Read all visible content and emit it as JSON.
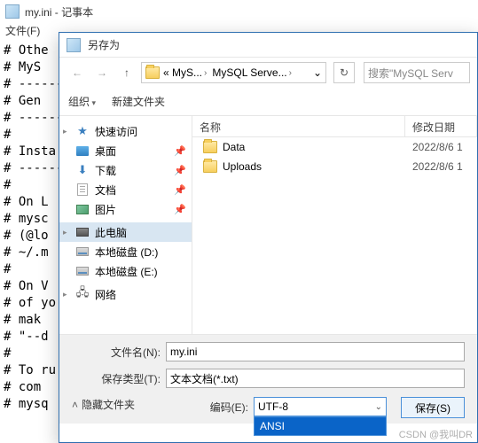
{
  "notepad": {
    "title": "my.ini - 记事本",
    "menu_file": "文件(F)",
    "body": "# Othe\n# MyS\n# ------\n# Gen\n# ------\n#\n# Insta\n# ------\n#\n# On L\n# mysc\n# (@lo\n# ~/.m\n#\n# On V\n# of yo\n# mak\n# \"--d\n#\n# To ru\n# com\n# mysq"
  },
  "dialog": {
    "title": "另存为",
    "nav": {
      "path_prefix": "« MyS...",
      "path_seg1": "MySQL Serve...",
      "search_placeholder": "搜索\"MySQL Serv"
    },
    "toolbar": {
      "organize": "组织",
      "newfolder": "新建文件夹"
    },
    "sidebar": {
      "quick": "快速访问",
      "desktop": "桌面",
      "downloads": "下载",
      "documents": "文档",
      "pictures": "图片",
      "thispc": "此电脑",
      "disk_d": "本地磁盘 (D:)",
      "disk_e": "本地磁盘 (E:)",
      "network": "网络"
    },
    "filelist": {
      "col_name": "名称",
      "col_date": "修改日期",
      "rows": [
        {
          "name": "Data",
          "date": "2022/8/6 1"
        },
        {
          "name": "Uploads",
          "date": "2022/8/6 1"
        }
      ]
    },
    "fields": {
      "filename_label": "文件名(N):",
      "filename_value": "my.ini",
      "savetype_label": "保存类型(T):",
      "savetype_value": "文本文档(*.txt)",
      "hide_folders": "隐藏文件夹",
      "encoding_label": "编码(E):",
      "encoding_value": "UTF-8",
      "encoding_opt_ansi": "ANSI",
      "save_btn": "保存(S)"
    }
  },
  "watermark": "CSDN @我叫DR"
}
